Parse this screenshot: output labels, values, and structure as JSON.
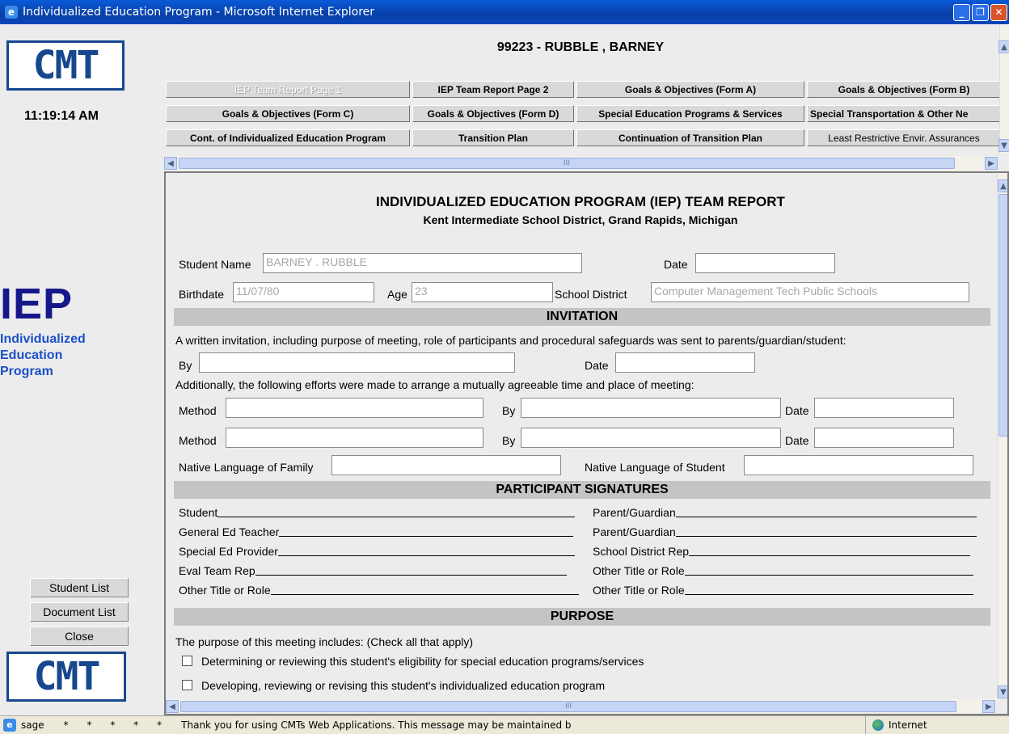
{
  "window": {
    "title": "Individualized Education Program - Microsoft Internet Explorer",
    "icon": "ie-icon"
  },
  "left": {
    "logo_text": "CMT",
    "clock": "11:19:14 AM",
    "iep_big": "IEP",
    "iep_sub": [
      "Individualized",
      "Education",
      "Program"
    ],
    "buttons": {
      "student_list": "Student List",
      "document_list": "Document List",
      "close": "Close"
    }
  },
  "top": {
    "student_title": "99223 - RUBBLE , BARNEY",
    "nav": [
      {
        "label": "IEP Team Report Page 1",
        "disabled": true
      },
      {
        "label": "IEP Team Report Page 2"
      },
      {
        "label": "Goals & Objectives (Form A)"
      },
      {
        "label": "Goals & Objectives (Form B)"
      },
      {
        "label": "Goals & Objectives (Form C)"
      },
      {
        "label": "Goals & Objectives (Form D)"
      },
      {
        "label": "Special Education Programs & Services"
      },
      {
        "label": "Special Transportation & Other Ne"
      },
      {
        "label": "Cont. of Individualized Education Program"
      },
      {
        "label": "Transition Plan"
      },
      {
        "label": "Continuation of Transition Plan"
      },
      {
        "label": "Least Restrictive Envir. Assurances"
      }
    ],
    "hscroll_label": "III"
  },
  "report": {
    "title": "INDIVIDUALIZED EDUCATION PROGRAM (IEP) TEAM REPORT",
    "subtitle": "Kent Intermediate School District, Grand Rapids, Michigan",
    "student_name_label": "Student Name",
    "student_name_value": "BARNEY . RUBBLE",
    "date_label": "Date",
    "date_value": "",
    "birthdate_label": "Birthdate",
    "birthdate_value": "11/07/80",
    "age_label": "Age",
    "age_value": "23",
    "school_district_label": "School District",
    "school_district_value": "Computer Management Tech Public Schools",
    "invitation": {
      "heading": "INVITATION",
      "text": "A written invitation, including purpose of meeting, role of participants and procedural safeguards was sent to parents/guardian/student:",
      "by_label": "By",
      "date_label": "Date",
      "efforts_text": "Additionally, the following efforts were made to arrange a mutually agreeable time and place of meeting:",
      "method_label": "Method",
      "by2_label": "By",
      "date2_label": "Date",
      "native_family_label": "Native Language of Family",
      "native_student_label": "Native Language of Student"
    },
    "signatures": {
      "heading": "PARTICIPANT SIGNATURES",
      "left": [
        "Student",
        "General Ed Teacher",
        "Special Ed Provider",
        "Eval Team Rep",
        "Other Title or Role"
      ],
      "right": [
        "Parent/Guardian",
        "Parent/Guardian",
        "School District Rep",
        "Other Title or Role",
        "Other Title or Role"
      ]
    },
    "purpose": {
      "heading": "PURPOSE",
      "intro": "The purpose of this meeting includes: (Check all that apply)",
      "items": [
        "Determining or reviewing this student's eligibility for special education programs/services",
        "Developing, reviewing or revising this student's individualized education program"
      ]
    },
    "hscroll_label": "III"
  },
  "status": {
    "left": "sage",
    "stars": "*      *      *      *      *",
    "message": "Thank you for using CMTs Web Applications.  This message may be maintained b",
    "zone": "Internet"
  }
}
